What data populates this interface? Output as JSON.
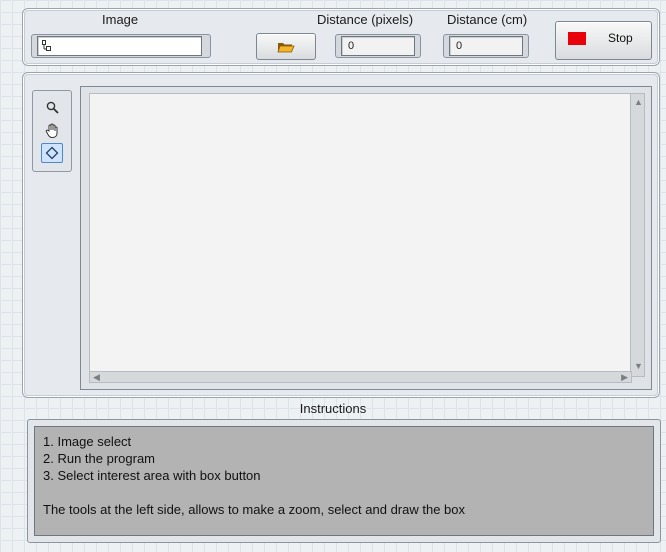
{
  "top_panel": {
    "image_label": "Image",
    "image_path_value": "",
    "distance_pixels_label": "Distance (pixels)",
    "distance_pixels_value": "0",
    "distance_cm_label": "Distance (cm)",
    "distance_cm_value": "0",
    "stop_label": "Stop",
    "browse_icon": "folder-open-icon",
    "stop_led_color": "#e8000b"
  },
  "tools": [
    {
      "name": "zoom",
      "icon": "magnifier-icon"
    },
    {
      "name": "pan",
      "icon": "hand-icon"
    },
    {
      "name": "rectangle",
      "icon": "diamond-selection-icon",
      "selected": true
    }
  ],
  "instructions": {
    "title": "Instructions",
    "lines": [
      "1. Image select",
      "2. Run the program",
      "3. Select interest area with box button"
    ],
    "note": "The tools at the left side, allows to make a zoom, select and draw the box"
  }
}
